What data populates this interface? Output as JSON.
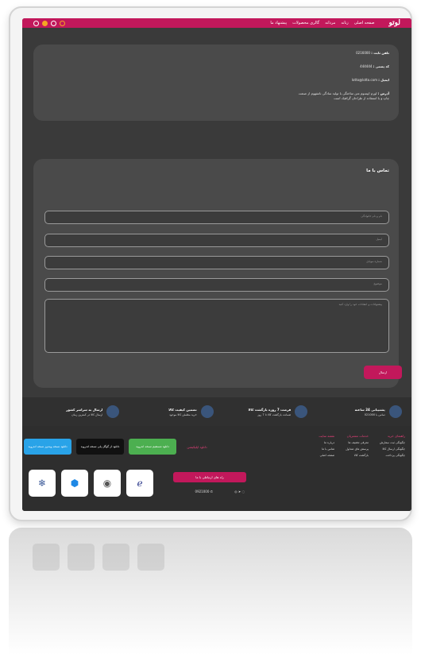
{
  "header": {
    "logo": "لوتو",
    "nav": [
      "صفحه اصلی",
      "زنانه",
      "مردانه",
      "گالری محصولات",
      "پیشنهاد ما"
    ]
  },
  "info": {
    "phone_label": "تلفن ثابت :",
    "phone_value": "0216000",
    "postal_label": "کد پستی :",
    "postal_value": "444444",
    "email_label": "ایمیل :",
    "email_value": "lotto@lotto.com",
    "address_label": "آدرس :",
    "address_value": "لورم ایپسوم متن ساختگی با تولید سادگی نامفهوم از صنعت چاپ و با استفاده از طراحان گرافیک است"
  },
  "contact": {
    "title": "تماس با ما",
    "name_placeholder": "نام و نام خانوادگی",
    "email_placeholder": "ایمیل",
    "phone_placeholder": "شماره موبایل",
    "subject_placeholder": "موضوع",
    "message_placeholder": "پیشنهادات و انتقادات خود را وارد کنید",
    "send_label": "ارسال"
  },
  "features": [
    {
      "title": "پشتیبانی 24 ساعته",
      "sub": "تماس با 021000"
    },
    {
      "title": "فرصت 7 روزه بازگشت کالا",
      "sub": "ضمانت بازگشت کالا تا 7 روز"
    },
    {
      "title": "تضمین کیفیت کالا",
      "sub": "خرید مطمئن کالا موجود"
    },
    {
      "title": "ارسال به سراسر کشور",
      "sub": "ارسال کالا در کمترین زمان"
    }
  ],
  "footer": {
    "col1": {
      "title": "راهنمای خرید",
      "items": [
        "چگونگی ثبت سفارش",
        "چگونگی ارسال کالا",
        "چگونگی پرداخت"
      ]
    },
    "col2": {
      "title": "خدمات مشتریان",
      "items": [
        "معرفی تخفیف ها",
        "پرسش های متداول",
        "بازگشت کالا"
      ]
    },
    "col3": {
      "title": "نقشه سایت",
      "items": [
        "درباره ما",
        "تماس با ما",
        "صفحه اصلی"
      ]
    },
    "download_label": "دانلود اپلیکیشن",
    "apps": [
      "دانلود مستقیم نسخه اندروید",
      "دانلود از گوگل پلی نسخه اندروید",
      "دانلود نسخه ویندوز نسخه اندروید"
    ],
    "contact_btn": "راه های ارتباطی با ما",
    "phone": "0921000"
  }
}
